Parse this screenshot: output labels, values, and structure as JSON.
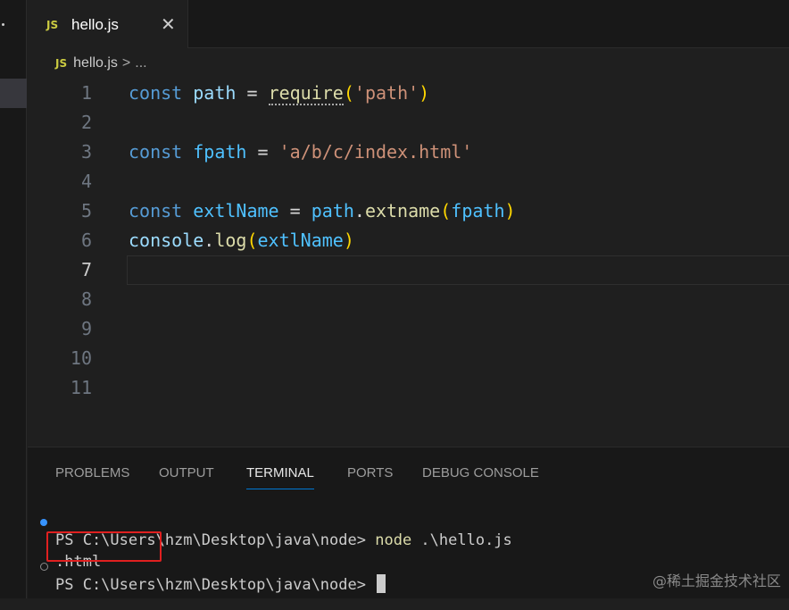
{
  "tab": {
    "badge": "JS",
    "title": "hello.js",
    "close": "✕"
  },
  "breadcrumb": {
    "badge": "JS",
    "file": "hello.js",
    "sep": ">",
    "more": "..."
  },
  "editor": {
    "current_line": 7,
    "lines": [
      {
        "n": "1",
        "tokens": [
          [
            "kw",
            "const"
          ],
          [
            "op",
            " "
          ],
          [
            "var",
            "path"
          ],
          [
            "op",
            " = "
          ],
          [
            "fn",
            "require"
          ],
          [
            "paren1",
            "("
          ],
          [
            "str",
            "'path'"
          ],
          [
            "paren1",
            ")"
          ]
        ]
      },
      {
        "n": "2",
        "tokens": []
      },
      {
        "n": "3",
        "tokens": [
          [
            "kw",
            "const"
          ],
          [
            "op",
            " "
          ],
          [
            "const",
            "fpath"
          ],
          [
            "op",
            " = "
          ],
          [
            "str",
            "'a/b/c/index.html'"
          ]
        ]
      },
      {
        "n": "4",
        "tokens": []
      },
      {
        "n": "5",
        "tokens": [
          [
            "kw",
            "const"
          ],
          [
            "op",
            " "
          ],
          [
            "const",
            "extlName"
          ],
          [
            "op",
            " = "
          ],
          [
            "const",
            "path"
          ],
          [
            "op",
            "."
          ],
          [
            "fn",
            "extname"
          ],
          [
            "paren1",
            "("
          ],
          [
            "const",
            "fpath"
          ],
          [
            "paren1",
            ")"
          ]
        ]
      },
      {
        "n": "6",
        "tokens": [
          [
            "var",
            "console"
          ],
          [
            "op",
            "."
          ],
          [
            "fn",
            "log"
          ],
          [
            "paren1",
            "("
          ],
          [
            "const",
            "extlName"
          ],
          [
            "paren1",
            ")"
          ]
        ]
      },
      {
        "n": "7",
        "tokens": []
      },
      {
        "n": "8",
        "tokens": []
      },
      {
        "n": "9",
        "tokens": []
      },
      {
        "n": "10",
        "tokens": []
      },
      {
        "n": "11",
        "tokens": []
      }
    ]
  },
  "panel": {
    "tabs": [
      "PROBLEMS",
      "OUTPUT",
      "TERMINAL",
      "PORTS",
      "DEBUG CONSOLE"
    ],
    "active_tab": "TERMINAL"
  },
  "terminal": {
    "line1_prompt": "PS C:\\Users\\hzm\\Desktop\\java\\node> ",
    "line1_cmd": "node",
    "line1_args": " .\\hello.js",
    "output": ".html",
    "line3_prompt": "PS C:\\Users\\hzm\\Desktop\\java\\node> "
  },
  "watermark": "@稀土掘金技术社区",
  "colors": {
    "keyword": "#569cd6",
    "variable": "#9cdcfe",
    "constant": "#4fc1ff",
    "function": "#dcdcaa",
    "string": "#ce9178",
    "bracket": "#ffd700",
    "highlight_box": "#e02020",
    "accent": "#0078d4"
  }
}
